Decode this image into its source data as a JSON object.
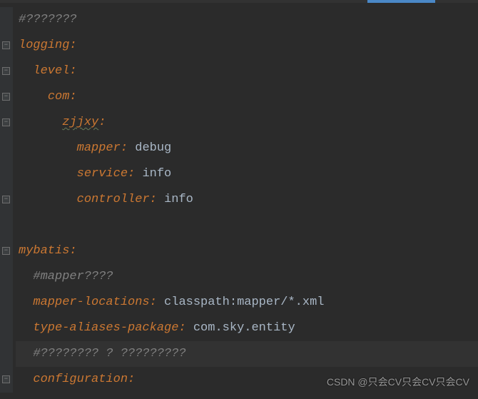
{
  "lines": {
    "l0_comment": "#???????",
    "l1_key": "logging",
    "l2_key": "level",
    "l3_key": "com",
    "l4_key": "zjjxy",
    "l5_key": "mapper",
    "l5_val": "debug",
    "l6_key": "service",
    "l6_val": "info",
    "l7_key": "controller",
    "l7_val": "info",
    "l9_key": "mybatis",
    "l10_comment": "#mapper????",
    "l11_key": "mapper-locations",
    "l11_val": "classpath:mapper/*.xml",
    "l12_key": "type-aliases-package",
    "l12_val": "com.sky.entity",
    "l13_comment": "#???????? ? ?????????",
    "l14_key": "configuration"
  },
  "watermark": "CSDN @只会CV只会CV只会CV",
  "colon": ":",
  "space": " "
}
